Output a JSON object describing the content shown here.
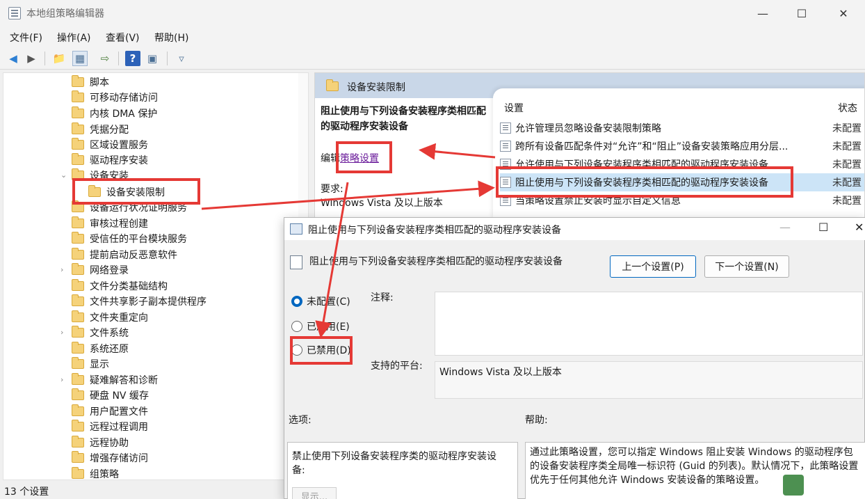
{
  "window": {
    "title": "本地组策略编辑器"
  },
  "menu": [
    "文件(F)",
    "操作(A)",
    "查看(V)",
    "帮助(H)"
  ],
  "tree": {
    "items": [
      {
        "label": "脚本"
      },
      {
        "label": "可移动存储访问"
      },
      {
        "label": "内核 DMA 保护"
      },
      {
        "label": "凭据分配"
      },
      {
        "label": "区域设置服务"
      },
      {
        "label": "驱动程序安装"
      },
      {
        "label": "设备安装"
      },
      {
        "label": "设备安装限制"
      },
      {
        "label": "设备运行状况证明服务"
      },
      {
        "label": "审核过程创建"
      },
      {
        "label": "受信任的平台模块服务"
      },
      {
        "label": "提前启动反恶意软件"
      },
      {
        "label": "网络登录"
      },
      {
        "label": "文件分类基础结构"
      },
      {
        "label": "文件共享影子副本提供程序"
      },
      {
        "label": "文件夹重定向"
      },
      {
        "label": "文件系统"
      },
      {
        "label": "系统还原"
      },
      {
        "label": "显示"
      },
      {
        "label": "疑难解答和诊断"
      },
      {
        "label": "硬盘 NV 缓存"
      },
      {
        "label": "用户配置文件"
      },
      {
        "label": "远程过程调用"
      },
      {
        "label": "远程协助"
      },
      {
        "label": "增强存储访问"
      },
      {
        "label": "组策略"
      }
    ]
  },
  "status": {
    "text": "13 个设置"
  },
  "right": {
    "header": "设备安装限制",
    "desc_title": "阻止使用与下列设备安装程序类相匹配的驱动程序安装设备",
    "edit_prefix": "编辑",
    "edit_link": "策略设置",
    "req_label": "要求:",
    "req_value": "Windows Vista 及以上版本",
    "col_setting": "设置",
    "col_state": "状态",
    "rows": [
      {
        "label": "允许管理员忽略设备安装限制策略",
        "state": "未配置"
      },
      {
        "label": "跨所有设备匹配条件对“允许”和“阻止”设备安装策略应用分层...",
        "state": "未配置"
      },
      {
        "label": "允许使用与下列设备安装程序类相匹配的驱动程序安装设备",
        "state": "未配置"
      },
      {
        "label": "阻止使用与下列设备安装程序类相匹配的驱动程序安装设备",
        "state": "未配置"
      },
      {
        "label": "当策略设置禁止安装时显示自定义信息",
        "state": "未配置"
      }
    ]
  },
  "dialog": {
    "title": "阻止使用与下列设备安装程序类相匹配的驱动程序安装设备",
    "subtitle": "阻止使用与下列设备安装程序类相匹配的驱动程序安装设备",
    "prev": "上一个设置(P)",
    "next": "下一个设置(N)",
    "radio_not_configured": "未配置(C)",
    "radio_enabled": "已启用(E)",
    "radio_disabled": "已禁用(D)",
    "selected_radio": "未配置(C)",
    "notes_label": "注释:",
    "platform_label": "支持的平台:",
    "platform_value": "Windows Vista 及以上版本",
    "options_label": "选项:",
    "help_label": "帮助:",
    "options_text": "禁止使用下列设备安装程序类的驱动程序安装设备:",
    "show_button": "显示...",
    "help_text": "通过此策略设置，您可以指定 Windows 阻止安装 Windows 的驱动程序包的设备安装程序类全局唯一标识符 (Guid 的列表)。默认情况下，此策略设置优先于任何其他允许 Windows 安装设备的策略设置。"
  },
  "colors": {
    "annotation": "#e53935",
    "header_bg": "#c9d7e8",
    "selection": "#cce4f7",
    "accent": "#0067c0"
  }
}
